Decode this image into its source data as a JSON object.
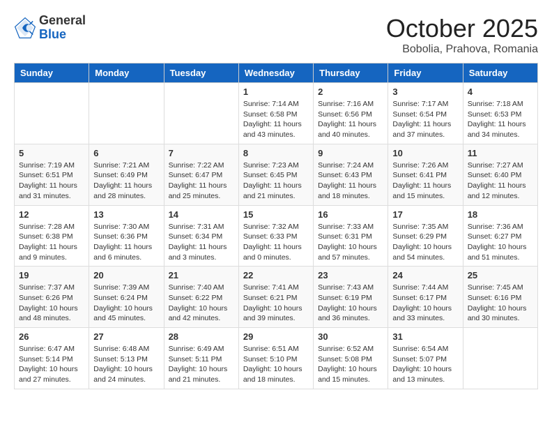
{
  "header": {
    "logo_general": "General",
    "logo_blue": "Blue",
    "month_title": "October 2025",
    "subtitle": "Bobolia, Prahova, Romania"
  },
  "weekdays": [
    "Sunday",
    "Monday",
    "Tuesday",
    "Wednesday",
    "Thursday",
    "Friday",
    "Saturday"
  ],
  "weeks": [
    [
      {
        "day": "",
        "sunrise": "",
        "sunset": "",
        "daylight": ""
      },
      {
        "day": "",
        "sunrise": "",
        "sunset": "",
        "daylight": ""
      },
      {
        "day": "",
        "sunrise": "",
        "sunset": "",
        "daylight": ""
      },
      {
        "day": "1",
        "sunrise": "Sunrise: 7:14 AM",
        "sunset": "Sunset: 6:58 PM",
        "daylight": "Daylight: 11 hours and 43 minutes."
      },
      {
        "day": "2",
        "sunrise": "Sunrise: 7:16 AM",
        "sunset": "Sunset: 6:56 PM",
        "daylight": "Daylight: 11 hours and 40 minutes."
      },
      {
        "day": "3",
        "sunrise": "Sunrise: 7:17 AM",
        "sunset": "Sunset: 6:54 PM",
        "daylight": "Daylight: 11 hours and 37 minutes."
      },
      {
        "day": "4",
        "sunrise": "Sunrise: 7:18 AM",
        "sunset": "Sunset: 6:53 PM",
        "daylight": "Daylight: 11 hours and 34 minutes."
      }
    ],
    [
      {
        "day": "5",
        "sunrise": "Sunrise: 7:19 AM",
        "sunset": "Sunset: 6:51 PM",
        "daylight": "Daylight: 11 hours and 31 minutes."
      },
      {
        "day": "6",
        "sunrise": "Sunrise: 7:21 AM",
        "sunset": "Sunset: 6:49 PM",
        "daylight": "Daylight: 11 hours and 28 minutes."
      },
      {
        "day": "7",
        "sunrise": "Sunrise: 7:22 AM",
        "sunset": "Sunset: 6:47 PM",
        "daylight": "Daylight: 11 hours and 25 minutes."
      },
      {
        "day": "8",
        "sunrise": "Sunrise: 7:23 AM",
        "sunset": "Sunset: 6:45 PM",
        "daylight": "Daylight: 11 hours and 21 minutes."
      },
      {
        "day": "9",
        "sunrise": "Sunrise: 7:24 AM",
        "sunset": "Sunset: 6:43 PM",
        "daylight": "Daylight: 11 hours and 18 minutes."
      },
      {
        "day": "10",
        "sunrise": "Sunrise: 7:26 AM",
        "sunset": "Sunset: 6:41 PM",
        "daylight": "Daylight: 11 hours and 15 minutes."
      },
      {
        "day": "11",
        "sunrise": "Sunrise: 7:27 AM",
        "sunset": "Sunset: 6:40 PM",
        "daylight": "Daylight: 11 hours and 12 minutes."
      }
    ],
    [
      {
        "day": "12",
        "sunrise": "Sunrise: 7:28 AM",
        "sunset": "Sunset: 6:38 PM",
        "daylight": "Daylight: 11 hours and 9 minutes."
      },
      {
        "day": "13",
        "sunrise": "Sunrise: 7:30 AM",
        "sunset": "Sunset: 6:36 PM",
        "daylight": "Daylight: 11 hours and 6 minutes."
      },
      {
        "day": "14",
        "sunrise": "Sunrise: 7:31 AM",
        "sunset": "Sunset: 6:34 PM",
        "daylight": "Daylight: 11 hours and 3 minutes."
      },
      {
        "day": "15",
        "sunrise": "Sunrise: 7:32 AM",
        "sunset": "Sunset: 6:33 PM",
        "daylight": "Daylight: 11 hours and 0 minutes."
      },
      {
        "day": "16",
        "sunrise": "Sunrise: 7:33 AM",
        "sunset": "Sunset: 6:31 PM",
        "daylight": "Daylight: 10 hours and 57 minutes."
      },
      {
        "day": "17",
        "sunrise": "Sunrise: 7:35 AM",
        "sunset": "Sunset: 6:29 PM",
        "daylight": "Daylight: 10 hours and 54 minutes."
      },
      {
        "day": "18",
        "sunrise": "Sunrise: 7:36 AM",
        "sunset": "Sunset: 6:27 PM",
        "daylight": "Daylight: 10 hours and 51 minutes."
      }
    ],
    [
      {
        "day": "19",
        "sunrise": "Sunrise: 7:37 AM",
        "sunset": "Sunset: 6:26 PM",
        "daylight": "Daylight: 10 hours and 48 minutes."
      },
      {
        "day": "20",
        "sunrise": "Sunrise: 7:39 AM",
        "sunset": "Sunset: 6:24 PM",
        "daylight": "Daylight: 10 hours and 45 minutes."
      },
      {
        "day": "21",
        "sunrise": "Sunrise: 7:40 AM",
        "sunset": "Sunset: 6:22 PM",
        "daylight": "Daylight: 10 hours and 42 minutes."
      },
      {
        "day": "22",
        "sunrise": "Sunrise: 7:41 AM",
        "sunset": "Sunset: 6:21 PM",
        "daylight": "Daylight: 10 hours and 39 minutes."
      },
      {
        "day": "23",
        "sunrise": "Sunrise: 7:43 AM",
        "sunset": "Sunset: 6:19 PM",
        "daylight": "Daylight: 10 hours and 36 minutes."
      },
      {
        "day": "24",
        "sunrise": "Sunrise: 7:44 AM",
        "sunset": "Sunset: 6:17 PM",
        "daylight": "Daylight: 10 hours and 33 minutes."
      },
      {
        "day": "25",
        "sunrise": "Sunrise: 7:45 AM",
        "sunset": "Sunset: 6:16 PM",
        "daylight": "Daylight: 10 hours and 30 minutes."
      }
    ],
    [
      {
        "day": "26",
        "sunrise": "Sunrise: 6:47 AM",
        "sunset": "Sunset: 5:14 PM",
        "daylight": "Daylight: 10 hours and 27 minutes."
      },
      {
        "day": "27",
        "sunrise": "Sunrise: 6:48 AM",
        "sunset": "Sunset: 5:13 PM",
        "daylight": "Daylight: 10 hours and 24 minutes."
      },
      {
        "day": "28",
        "sunrise": "Sunrise: 6:49 AM",
        "sunset": "Sunset: 5:11 PM",
        "daylight": "Daylight: 10 hours and 21 minutes."
      },
      {
        "day": "29",
        "sunrise": "Sunrise: 6:51 AM",
        "sunset": "Sunset: 5:10 PM",
        "daylight": "Daylight: 10 hours and 18 minutes."
      },
      {
        "day": "30",
        "sunrise": "Sunrise: 6:52 AM",
        "sunset": "Sunset: 5:08 PM",
        "daylight": "Daylight: 10 hours and 15 minutes."
      },
      {
        "day": "31",
        "sunrise": "Sunrise: 6:54 AM",
        "sunset": "Sunset: 5:07 PM",
        "daylight": "Daylight: 10 hours and 13 minutes."
      },
      {
        "day": "",
        "sunrise": "",
        "sunset": "",
        "daylight": ""
      }
    ]
  ]
}
